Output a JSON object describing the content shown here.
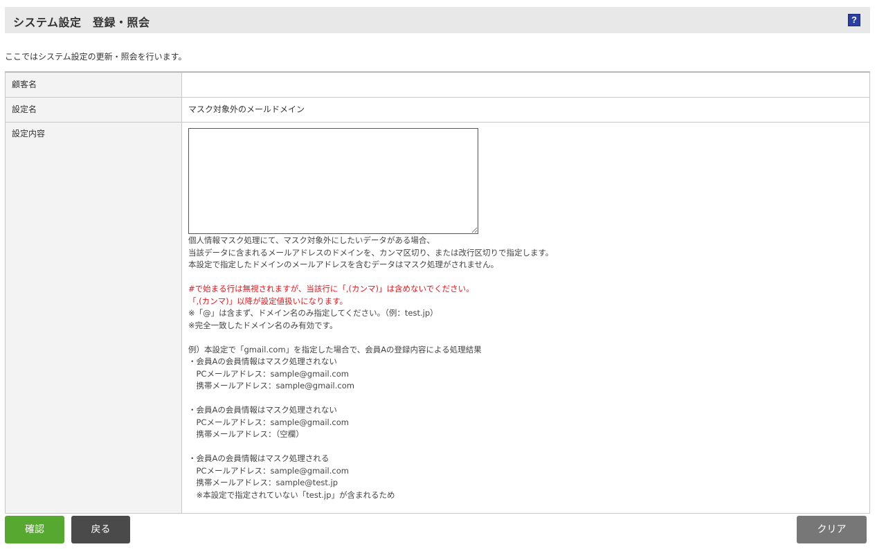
{
  "header": {
    "title": "システム設定　登録・照会",
    "help_icon": "?"
  },
  "intro": "ここではシステム設定の更新・照会を行います。",
  "rows": {
    "customer": {
      "label": "顧客名",
      "value": ""
    },
    "setting_name": {
      "label": "設定名",
      "value": "マスク対象外のメールドメイン"
    },
    "setting_content": {
      "label": "設定内容",
      "value": ""
    }
  },
  "notes": [
    {
      "text": "個人情報マスク処理にて、マスク対象外にしたいデータがある場合、",
      "red": false
    },
    {
      "text": "当該データに含まれるメールアドレスのドメインを、カンマ区切り、または改行区切りで指定します。",
      "red": false
    },
    {
      "text": "本設定で指定したドメインのメールアドレスを含むデータはマスク処理がされません。",
      "red": false
    },
    {
      "text": "",
      "red": false
    },
    {
      "text": "#で始まる行は無視されますが、当該行に「,(カンマ)」は含めないでください。",
      "red": true
    },
    {
      "text": "「,(カンマ)」以降が設定値扱いになります。",
      "red": true
    },
    {
      "text": "※「@」は含まず、ドメイン名のみ指定してください。（例：test.jp）",
      "red": false
    },
    {
      "text": "※完全一致したドメイン名のみ有効です。",
      "red": false
    },
    {
      "text": "",
      "red": false
    },
    {
      "text": "例）本設定で「gmail.com」を指定した場合で、会員Aの登録内容による処理結果",
      "red": false
    },
    {
      "text": "・会員Aの会員情報はマスク処理されない",
      "red": false
    },
    {
      "text": "　PCメールアドレス：sample@gmail.com",
      "red": false
    },
    {
      "text": "　携帯メールアドレス：sample@gmail.com",
      "red": false
    },
    {
      "text": "",
      "red": false
    },
    {
      "text": "・会員Aの会員情報はマスク処理されない",
      "red": false
    },
    {
      "text": "　PCメールアドレス：sample@gmail.com",
      "red": false
    },
    {
      "text": "　携帯メールアドレス：（空欄）",
      "red": false
    },
    {
      "text": "",
      "red": false
    },
    {
      "text": "・会員Aの会員情報はマスク処理される",
      "red": false
    },
    {
      "text": "　PCメールアドレス：sample@gmail.com",
      "red": false
    },
    {
      "text": "　携帯メールアドレス：sample@test.jp",
      "red": false
    },
    {
      "text": "　※本設定で指定されていない「test.jp」が含まれるため",
      "red": false
    }
  ],
  "buttons": {
    "confirm": "確認",
    "back": "戻る",
    "clear": "クリア"
  },
  "colors": {
    "confirm_button": "#56a830",
    "back_button": "#4a4a4a",
    "clear_button": "#777777",
    "warning_text": "#e8161b",
    "help_icon": "#2a3fa3"
  }
}
